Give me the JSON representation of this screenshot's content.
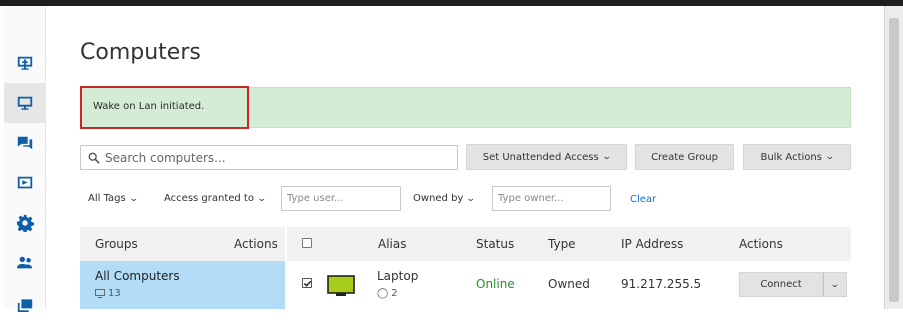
{
  "sidebar": {
    "items": [
      {
        "name": "add-computer-icon"
      },
      {
        "name": "monitor-icon"
      },
      {
        "name": "chat-icon"
      },
      {
        "name": "presentation-icon"
      },
      {
        "name": "gear-icon"
      },
      {
        "name": "users-icon"
      },
      {
        "name": "deploy-icon"
      }
    ]
  },
  "page": {
    "title": "Computers"
  },
  "alert": {
    "message": "Wake on Lan initiated."
  },
  "search": {
    "placeholder": "Search computers..."
  },
  "toolbar": {
    "set_unattended": "Set Unattended Access",
    "create_group": "Create Group",
    "bulk_actions": "Bulk Actions"
  },
  "filters": {
    "all_tags": "All Tags",
    "access_granted_to": "Access granted to",
    "user_placeholder": "Type user...",
    "owned_by": "Owned by",
    "owner_placeholder": "Type owner...",
    "clear": "Clear"
  },
  "groups_table": {
    "headers": {
      "groups": "Groups",
      "actions": "Actions"
    },
    "rows": [
      {
        "name": "All Computers",
        "count": "13"
      }
    ]
  },
  "computers_table": {
    "headers": {
      "alias": "Alias",
      "status": "Status",
      "type": "Type",
      "ip": "IP Address",
      "actions": "Actions"
    },
    "rows": [
      {
        "alias": "Laptop",
        "tags": "2",
        "status": "Online",
        "type": "Owned",
        "ip": "91.217.255.5",
        "action": "Connect",
        "checked": true
      }
    ]
  },
  "colors": {
    "accent": "#0f5ea8",
    "online": "#2e8b2e",
    "selected_group": "#b3dcf7",
    "alert_bg": "#d4ebd6",
    "highlight": "#c62828"
  }
}
